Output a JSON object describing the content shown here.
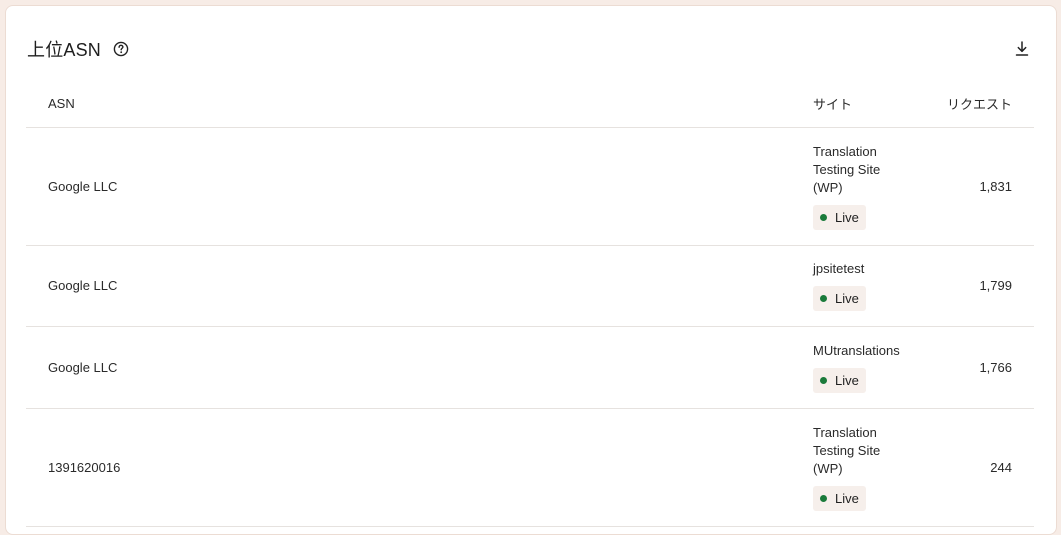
{
  "panel": {
    "title": "上位ASN",
    "help_icon": "question-circle-icon",
    "download_icon": "download-icon"
  },
  "table": {
    "columns": {
      "asn": "ASN",
      "site": "サイト",
      "requests": "リクエスト"
    },
    "rows": [
      {
        "asn": "Google LLC",
        "site": "Translation Testing Site (WP)",
        "status": "Live",
        "requests": "1,831"
      },
      {
        "asn": "Google LLC",
        "site": "jpsitetest",
        "status": "Live",
        "requests": "1,799"
      },
      {
        "asn": "Google LLC",
        "site": "MUtranslations",
        "status": "Live",
        "requests": "1,766"
      },
      {
        "asn": "1391620016",
        "site": "Translation Testing Site (WP)",
        "status": "Live",
        "requests": "244"
      }
    ]
  },
  "colors": {
    "live_dot": "#1a7a3a",
    "badge_bg": "#f6efeb",
    "page_bg": "#f7ece6"
  }
}
